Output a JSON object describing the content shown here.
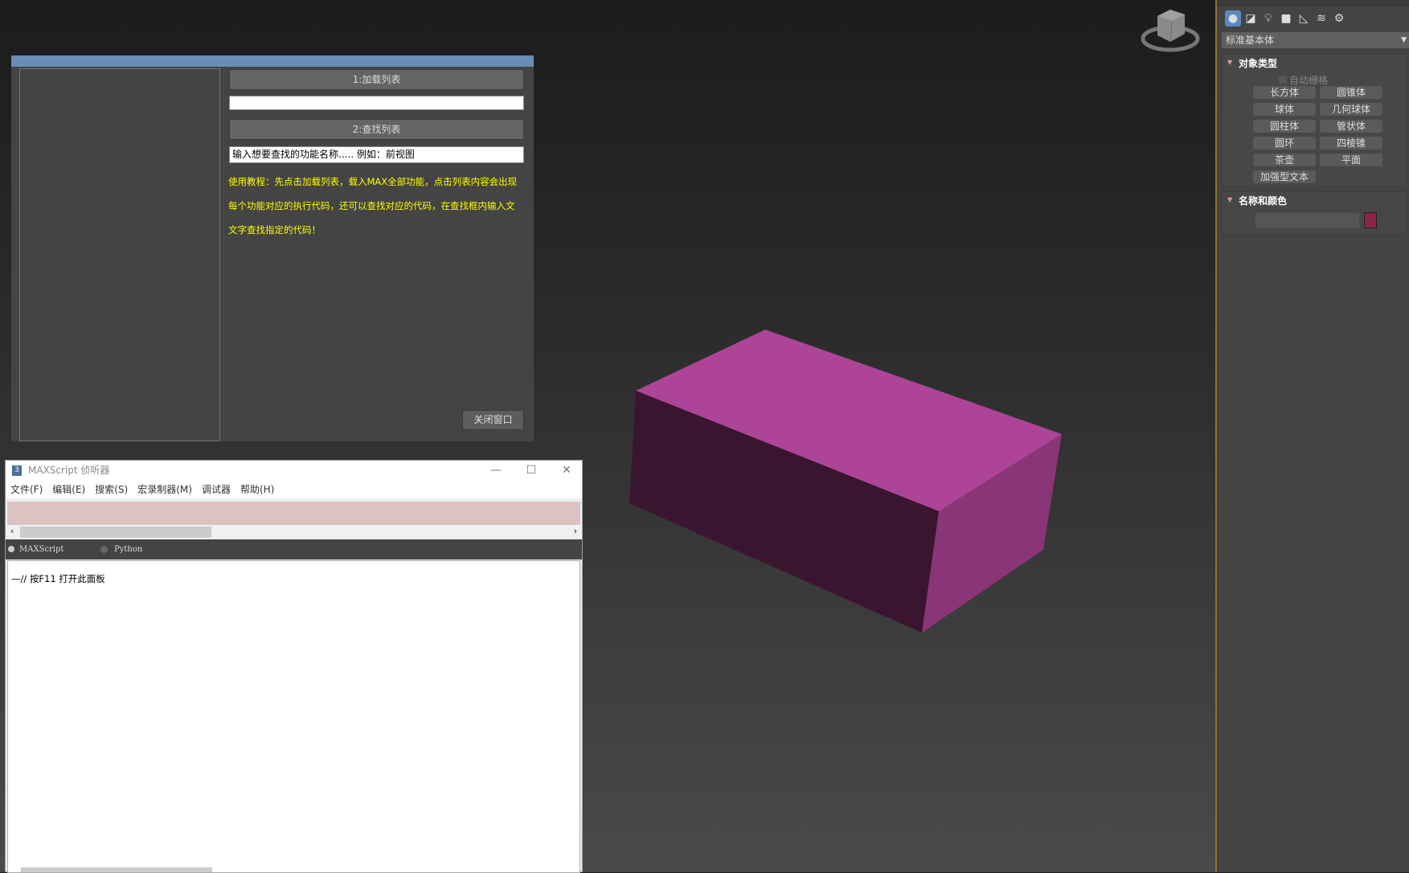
{
  "dialog": {
    "load_button": "1:加载列表",
    "load_input_value": "",
    "find_button": "2:查找列表",
    "search_input_value": "输入想要查找的功能名称.....  例如：前视图",
    "help_lines": [
      "使用教程：先点击加载列表，载入MAX全部功能，点击列表内容会出现",
      "每个功能对应的执行代码，还可以查找对应的代码，在查找框内输入文",
      "文字查找指定的代码！"
    ],
    "close_button": "关闭窗口",
    "titlebar_color": "#6a8db5",
    "help_color": "#ffff00"
  },
  "listener": {
    "title": "MAXScript 侦听器",
    "app_icon_label": "3",
    "menu": [
      "文件(F)",
      "编辑(E)",
      "搜索(S)",
      "宏录制器(M)",
      "调试器",
      "帮助(H)"
    ],
    "languages": [
      "MAXScript",
      "Python"
    ],
    "selected_language": "MAXScript",
    "output_text": "—// 按F11 打开此面板",
    "macro_area_color": "#dbc3c3"
  },
  "panel": {
    "icons": [
      "geometry-icon",
      "shapes-icon",
      "lights-icon",
      "cameras-icon",
      "helpers-icon",
      "spacewarps-icon",
      "systems-icon"
    ],
    "category": "标准基本体",
    "rollout_object_type": "对象类型",
    "autogrid_label": "自动栅格",
    "primitives": [
      "长方体",
      "圆锥体",
      "球体",
      "几何球体",
      "圆柱体",
      "管状体",
      "圆环",
      "四棱锥",
      "茶壶",
      "平面",
      "加强型文本"
    ],
    "rollout_name_color": "名称和颜色",
    "object_name": "",
    "object_color": "#8b2344"
  },
  "viewport": {
    "object_color_top": "#ad4498",
    "object_color_front": "#3a1530",
    "object_color_side": "#8a3577"
  }
}
